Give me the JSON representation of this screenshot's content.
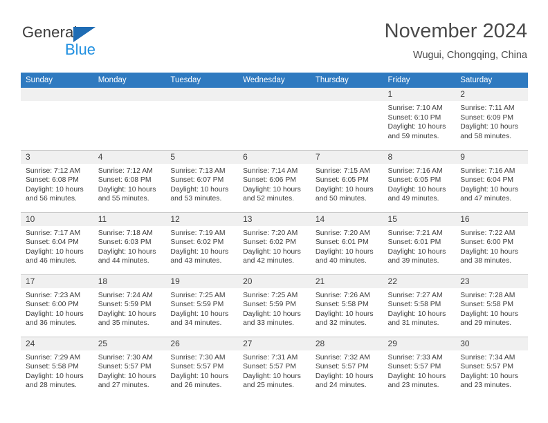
{
  "logo": {
    "word1": "General",
    "word2": "Blue",
    "triangle_color": "#1f6cb4",
    "blue_color": "#1f8fe0"
  },
  "header": {
    "title": "November 2024",
    "subtitle": "Wugui, Chongqing, China"
  },
  "theme": {
    "header_bg": "#2f7ac0",
    "daynum_band_bg": "#f0f0f0",
    "grid_line": "#c9c9c9",
    "text": "#3d3d3d"
  },
  "weekday_headers": [
    "Sunday",
    "Monday",
    "Tuesday",
    "Wednesday",
    "Thursday",
    "Friday",
    "Saturday"
  ],
  "weeks": [
    [
      {
        "day": "",
        "sunrise": "",
        "sunset": "",
        "daylight1": "",
        "daylight2": ""
      },
      {
        "day": "",
        "sunrise": "",
        "sunset": "",
        "daylight1": "",
        "daylight2": ""
      },
      {
        "day": "",
        "sunrise": "",
        "sunset": "",
        "daylight1": "",
        "daylight2": ""
      },
      {
        "day": "",
        "sunrise": "",
        "sunset": "",
        "daylight1": "",
        "daylight2": ""
      },
      {
        "day": "",
        "sunrise": "",
        "sunset": "",
        "daylight1": "",
        "daylight2": ""
      },
      {
        "day": "1",
        "sunrise": "Sunrise: 7:10 AM",
        "sunset": "Sunset: 6:10 PM",
        "daylight1": "Daylight: 10 hours",
        "daylight2": "and 59 minutes."
      },
      {
        "day": "2",
        "sunrise": "Sunrise: 7:11 AM",
        "sunset": "Sunset: 6:09 PM",
        "daylight1": "Daylight: 10 hours",
        "daylight2": "and 58 minutes."
      }
    ],
    [
      {
        "day": "3",
        "sunrise": "Sunrise: 7:12 AM",
        "sunset": "Sunset: 6:08 PM",
        "daylight1": "Daylight: 10 hours",
        "daylight2": "and 56 minutes."
      },
      {
        "day": "4",
        "sunrise": "Sunrise: 7:12 AM",
        "sunset": "Sunset: 6:08 PM",
        "daylight1": "Daylight: 10 hours",
        "daylight2": "and 55 minutes."
      },
      {
        "day": "5",
        "sunrise": "Sunrise: 7:13 AM",
        "sunset": "Sunset: 6:07 PM",
        "daylight1": "Daylight: 10 hours",
        "daylight2": "and 53 minutes."
      },
      {
        "day": "6",
        "sunrise": "Sunrise: 7:14 AM",
        "sunset": "Sunset: 6:06 PM",
        "daylight1": "Daylight: 10 hours",
        "daylight2": "and 52 minutes."
      },
      {
        "day": "7",
        "sunrise": "Sunrise: 7:15 AM",
        "sunset": "Sunset: 6:05 PM",
        "daylight1": "Daylight: 10 hours",
        "daylight2": "and 50 minutes."
      },
      {
        "day": "8",
        "sunrise": "Sunrise: 7:16 AM",
        "sunset": "Sunset: 6:05 PM",
        "daylight1": "Daylight: 10 hours",
        "daylight2": "and 49 minutes."
      },
      {
        "day": "9",
        "sunrise": "Sunrise: 7:16 AM",
        "sunset": "Sunset: 6:04 PM",
        "daylight1": "Daylight: 10 hours",
        "daylight2": "and 47 minutes."
      }
    ],
    [
      {
        "day": "10",
        "sunrise": "Sunrise: 7:17 AM",
        "sunset": "Sunset: 6:04 PM",
        "daylight1": "Daylight: 10 hours",
        "daylight2": "and 46 minutes."
      },
      {
        "day": "11",
        "sunrise": "Sunrise: 7:18 AM",
        "sunset": "Sunset: 6:03 PM",
        "daylight1": "Daylight: 10 hours",
        "daylight2": "and 44 minutes."
      },
      {
        "day": "12",
        "sunrise": "Sunrise: 7:19 AM",
        "sunset": "Sunset: 6:02 PM",
        "daylight1": "Daylight: 10 hours",
        "daylight2": "and 43 minutes."
      },
      {
        "day": "13",
        "sunrise": "Sunrise: 7:20 AM",
        "sunset": "Sunset: 6:02 PM",
        "daylight1": "Daylight: 10 hours",
        "daylight2": "and 42 minutes."
      },
      {
        "day": "14",
        "sunrise": "Sunrise: 7:20 AM",
        "sunset": "Sunset: 6:01 PM",
        "daylight1": "Daylight: 10 hours",
        "daylight2": "and 40 minutes."
      },
      {
        "day": "15",
        "sunrise": "Sunrise: 7:21 AM",
        "sunset": "Sunset: 6:01 PM",
        "daylight1": "Daylight: 10 hours",
        "daylight2": "and 39 minutes."
      },
      {
        "day": "16",
        "sunrise": "Sunrise: 7:22 AM",
        "sunset": "Sunset: 6:00 PM",
        "daylight1": "Daylight: 10 hours",
        "daylight2": "and 38 minutes."
      }
    ],
    [
      {
        "day": "17",
        "sunrise": "Sunrise: 7:23 AM",
        "sunset": "Sunset: 6:00 PM",
        "daylight1": "Daylight: 10 hours",
        "daylight2": "and 36 minutes."
      },
      {
        "day": "18",
        "sunrise": "Sunrise: 7:24 AM",
        "sunset": "Sunset: 5:59 PM",
        "daylight1": "Daylight: 10 hours",
        "daylight2": "and 35 minutes."
      },
      {
        "day": "19",
        "sunrise": "Sunrise: 7:25 AM",
        "sunset": "Sunset: 5:59 PM",
        "daylight1": "Daylight: 10 hours",
        "daylight2": "and 34 minutes."
      },
      {
        "day": "20",
        "sunrise": "Sunrise: 7:25 AM",
        "sunset": "Sunset: 5:59 PM",
        "daylight1": "Daylight: 10 hours",
        "daylight2": "and 33 minutes."
      },
      {
        "day": "21",
        "sunrise": "Sunrise: 7:26 AM",
        "sunset": "Sunset: 5:58 PM",
        "daylight1": "Daylight: 10 hours",
        "daylight2": "and 32 minutes."
      },
      {
        "day": "22",
        "sunrise": "Sunrise: 7:27 AM",
        "sunset": "Sunset: 5:58 PM",
        "daylight1": "Daylight: 10 hours",
        "daylight2": "and 31 minutes."
      },
      {
        "day": "23",
        "sunrise": "Sunrise: 7:28 AM",
        "sunset": "Sunset: 5:58 PM",
        "daylight1": "Daylight: 10 hours",
        "daylight2": "and 29 minutes."
      }
    ],
    [
      {
        "day": "24",
        "sunrise": "Sunrise: 7:29 AM",
        "sunset": "Sunset: 5:58 PM",
        "daylight1": "Daylight: 10 hours",
        "daylight2": "and 28 minutes."
      },
      {
        "day": "25",
        "sunrise": "Sunrise: 7:30 AM",
        "sunset": "Sunset: 5:57 PM",
        "daylight1": "Daylight: 10 hours",
        "daylight2": "and 27 minutes."
      },
      {
        "day": "26",
        "sunrise": "Sunrise: 7:30 AM",
        "sunset": "Sunset: 5:57 PM",
        "daylight1": "Daylight: 10 hours",
        "daylight2": "and 26 minutes."
      },
      {
        "day": "27",
        "sunrise": "Sunrise: 7:31 AM",
        "sunset": "Sunset: 5:57 PM",
        "daylight1": "Daylight: 10 hours",
        "daylight2": "and 25 minutes."
      },
      {
        "day": "28",
        "sunrise": "Sunrise: 7:32 AM",
        "sunset": "Sunset: 5:57 PM",
        "daylight1": "Daylight: 10 hours",
        "daylight2": "and 24 minutes."
      },
      {
        "day": "29",
        "sunrise": "Sunrise: 7:33 AM",
        "sunset": "Sunset: 5:57 PM",
        "daylight1": "Daylight: 10 hours",
        "daylight2": "and 23 minutes."
      },
      {
        "day": "30",
        "sunrise": "Sunrise: 7:34 AM",
        "sunset": "Sunset: 5:57 PM",
        "daylight1": "Daylight: 10 hours",
        "daylight2": "and 23 minutes."
      }
    ]
  ]
}
